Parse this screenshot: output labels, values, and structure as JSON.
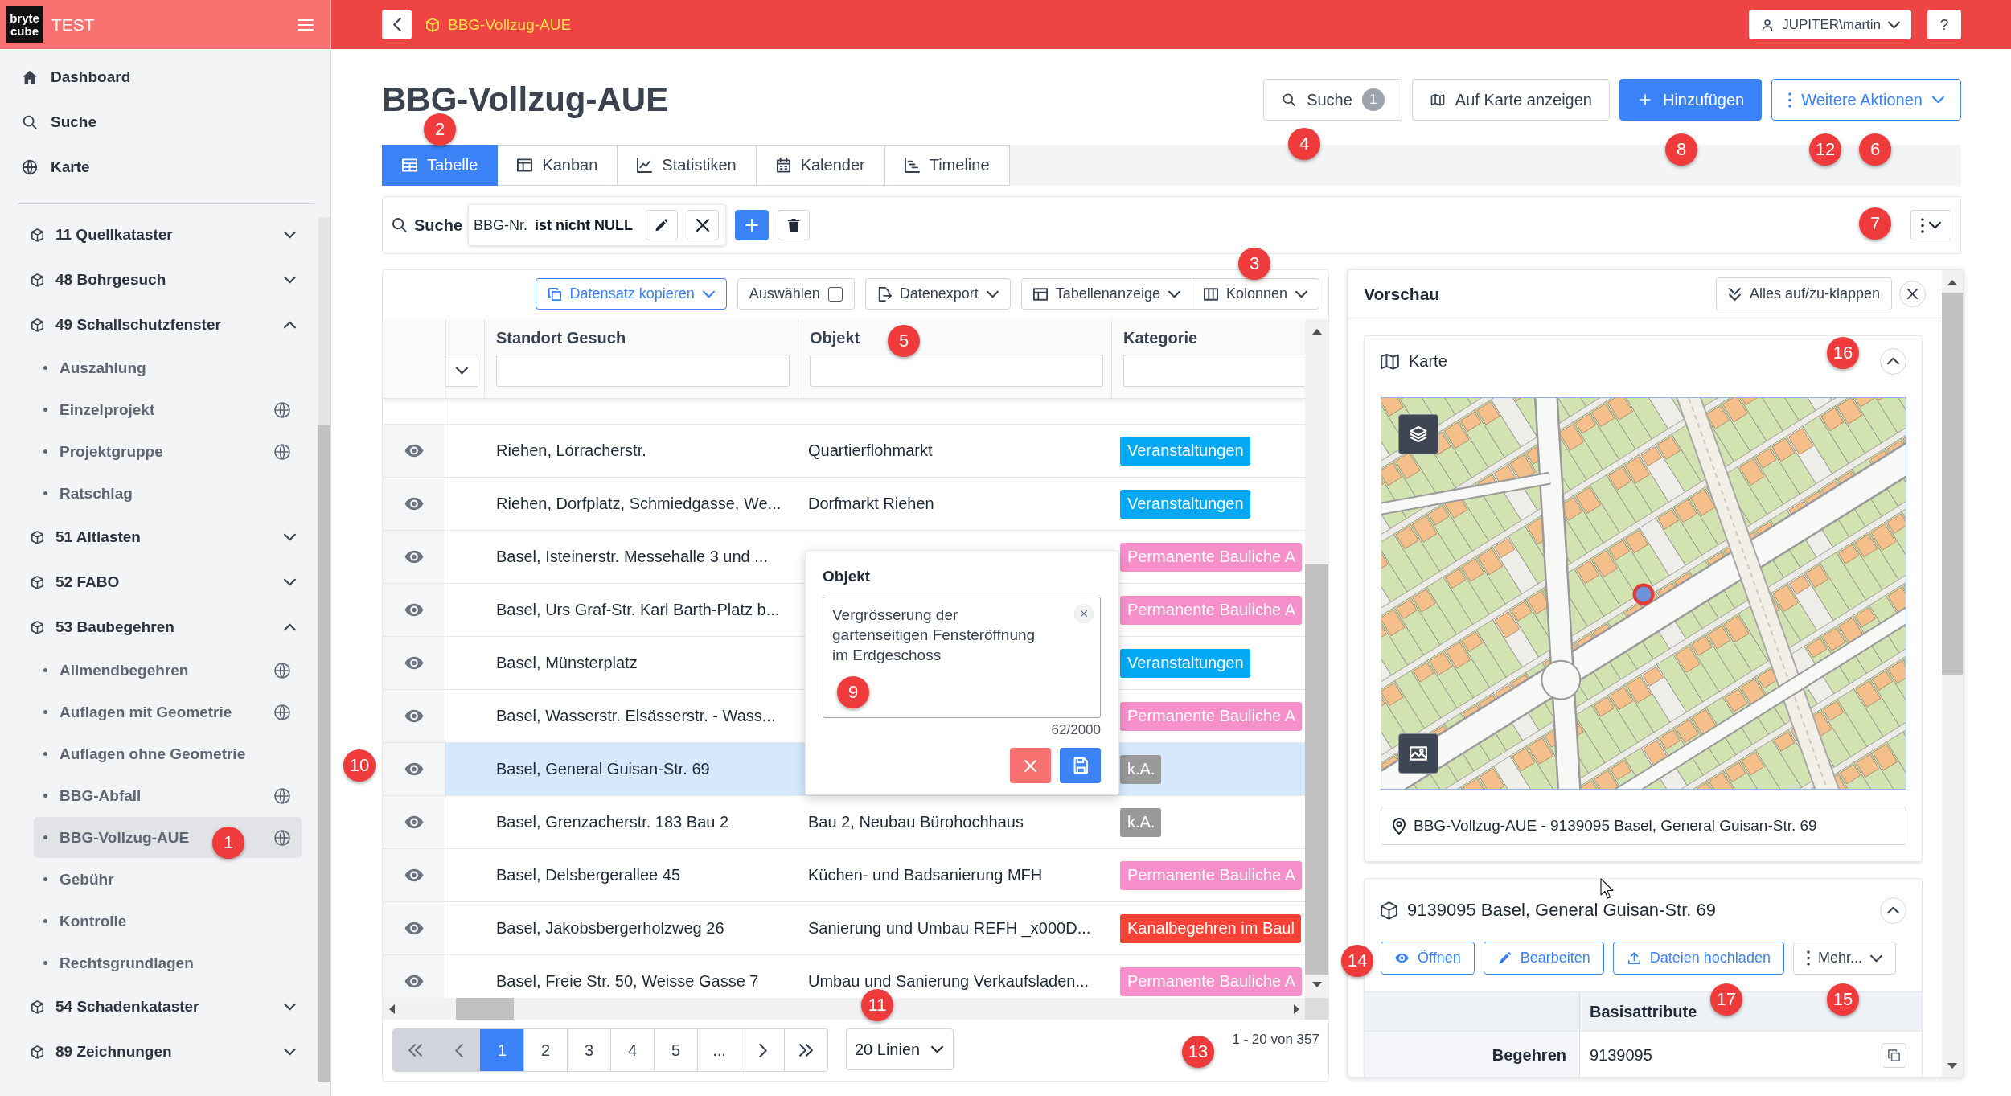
{
  "sidebar": {
    "logo": [
      "bryte",
      "cube"
    ],
    "title": "TEST",
    "nav": [
      {
        "kind": "dashboard",
        "label": "Dashboard"
      },
      {
        "kind": "search",
        "label": "Suche"
      },
      {
        "kind": "map",
        "label": "Karte"
      }
    ],
    "groups": [
      {
        "label": "11 Quellkataster",
        "expanded": false
      },
      {
        "label": "48 Bohrgesuch",
        "expanded": false
      },
      {
        "label": "49 Schallschutzfenster",
        "expanded": true,
        "children": [
          {
            "label": "Auszahlung",
            "globe_icon": false,
            "selected": false
          },
          {
            "label": "Einzelprojekt",
            "globe_icon": true,
            "selected": false
          },
          {
            "label": "Projektgruppe",
            "globe_icon": true,
            "selected": false
          },
          {
            "label": "Ratschlag",
            "globe_icon": false,
            "selected": false
          }
        ]
      },
      {
        "label": "51 Altlasten",
        "expanded": false
      },
      {
        "label": "52 FABO",
        "expanded": false
      },
      {
        "label": "53 Baubegehren",
        "expanded": true,
        "children": [
          {
            "label": "Allmendbegehren",
            "globe_icon": true,
            "selected": false
          },
          {
            "label": "Auflagen mit Geometrie",
            "globe_icon": true,
            "selected": false
          },
          {
            "label": "Auflagen ohne Geometrie",
            "globe_icon": false,
            "selected": false
          },
          {
            "label": "BBG-Abfall",
            "globe_icon": true,
            "selected": false
          },
          {
            "label": "BBG-Vollzug-AUE",
            "globe_icon": true,
            "selected": true
          },
          {
            "label": "Gebühr",
            "globe_icon": false,
            "selected": false
          },
          {
            "label": "Kontrolle",
            "globe_icon": false,
            "selected": false
          },
          {
            "label": "Rechtsgrundlagen",
            "globe_icon": false,
            "selected": false
          }
        ]
      },
      {
        "label": "54 Schadenkataster",
        "expanded": false
      },
      {
        "label": "89 Zeichnungen",
        "expanded": false
      }
    ]
  },
  "topbar": {
    "breadcrumb": "BBG-Vollzug-AUE",
    "user": "JUPITER\\martin",
    "help": "?"
  },
  "page": {
    "title": "BBG-Vollzug-AUE",
    "actions": [
      {
        "kind": "search",
        "label": "Suche",
        "count": "1"
      },
      {
        "kind": "map",
        "label": "Auf Karte anzeigen"
      },
      {
        "kind": "add",
        "label": "Hinzufügen"
      },
      {
        "kind": "more",
        "label": "Weitere Aktionen"
      }
    ]
  },
  "view_tabs": [
    {
      "kind": "table",
      "label": "Tabelle",
      "selected": true
    },
    {
      "kind": "kanban",
      "label": "Kanban",
      "selected": false
    },
    {
      "kind": "chart",
      "label": "Statistiken",
      "selected": false
    },
    {
      "kind": "calendar",
      "label": "Kalender",
      "selected": false
    },
    {
      "kind": "timeline",
      "label": "Timeline",
      "selected": false
    }
  ],
  "filter_bar": {
    "label": "Suche",
    "field": "BBG-Nr.",
    "condition": "ist nicht NULL"
  },
  "table_toolbar": [
    {
      "kind": "copy",
      "label": "Datensatz kopieren"
    },
    {
      "kind": "select",
      "label": "Auswählen",
      "checked": false
    },
    {
      "kind": "export",
      "label": "Datenexport"
    },
    {
      "kind": "layout",
      "label": "Tabellenanzeige"
    },
    {
      "kind": "columns",
      "label": "Kolonnen"
    }
  ],
  "table": {
    "columns": [
      {
        "label": "Standort Gesuch"
      },
      {
        "label": "Objekt"
      },
      {
        "label": "Kategorie"
      }
    ],
    "rows": [
      {
        "standort": "Riehen, Lörracherstr.",
        "objekt": "Quartierflohmarkt",
        "kategorie": {
          "label": "Veranstaltungen",
          "color": "#03a9f4"
        },
        "selected": false
      },
      {
        "standort": "Riehen, Dorfplatz, Schmiedgasse, We...",
        "objekt": "Dorfmarkt Riehen",
        "kategorie": {
          "label": "Veranstaltungen",
          "color": "#03a9f4"
        },
        "selected": false
      },
      {
        "standort": "Basel, Isteinerstr. Messehalle 3 und ...",
        "kategorie": {
          "label": "Permanente Bauliche A",
          "color": "#f78fcb"
        },
        "selected": false
      },
      {
        "standort": "Basel, Urs Graf-Str. Karl Barth-Platz b...",
        "kategorie": {
          "label": "Permanente Bauliche A",
          "color": "#f78fcb"
        },
        "selected": false
      },
      {
        "standort": "Basel, Münsterplatz",
        "kategorie": {
          "label": "Veranstaltungen",
          "color": "#03a9f4"
        },
        "selected": false
      },
      {
        "standort": "Basel, Wasserstr. Elsässerstr. - Wass...",
        "kategorie": {
          "label": "Permanente Bauliche A",
          "color": "#f78fcb"
        },
        "selected": false
      },
      {
        "standort": "Basel, General Guisan-Str. 69",
        "kategorie": {
          "label": "k.A.",
          "color": "#999999"
        },
        "selected": true
      },
      {
        "standort": "Basel, Grenzacherstr. 183 Bau 2",
        "objekt": "Bau 2, Neubau Bürohochhaus",
        "kategorie": {
          "label": "k.A.",
          "color": "#999999"
        },
        "selected": false
      },
      {
        "standort": "Basel, Delsbergerallee 45",
        "objekt": "Küchen- und Badsanierung MFH",
        "kategorie": {
          "label": "Permanente Bauliche A",
          "color": "#f78fcb"
        },
        "selected": false
      },
      {
        "standort": "Basel, Jakobsbergerholzweg 26",
        "objekt": "Sanierung und Umbau REFH _x000D...",
        "kategorie": {
          "label": "Kanalbegehren im Baul",
          "color": "#f44336"
        },
        "selected": false
      },
      {
        "standort": "Basel, Freie Str. 50, Weisse Gasse 7",
        "objekt": "Umbau und Sanierung Verkaufsladen...",
        "kategorie": {
          "label": "Permanente Bauliche A",
          "color": "#f78fcb"
        },
        "selected": false
      }
    ],
    "pagination": {
      "prev_disabled": true,
      "pages": [
        {
          "label": "1",
          "selected": true
        },
        {
          "label": "2",
          "selected": false
        },
        {
          "label": "3",
          "selected": false
        },
        {
          "label": "4",
          "selected": false
        },
        {
          "label": "5",
          "selected": false
        },
        {
          "label": "...",
          "selected": false
        }
      ],
      "page_size": "20 Linien",
      "range": "1 - 20 von 357"
    }
  },
  "edit_popup": {
    "label": "Objekt",
    "value": "Vergrösserung der gartenseitigen Fensteröffnung im Erdgeschoss",
    "counter": "62/2000"
  },
  "preview": {
    "title": "Vorschau",
    "toggle_all": "Alles auf/zu-klappen",
    "map_card": {
      "title": "Karte",
      "expanded": true,
      "location": "BBG-Vollzug-AUE - 9139095 Basel, General Guisan-Str. 69"
    },
    "record_card": {
      "title": "9139095 Basel, General Guisan-Str. 69",
      "expanded": true,
      "buttons": [
        {
          "kind": "open",
          "label": "Öffnen"
        },
        {
          "kind": "edit",
          "label": "Bearbeiten"
        },
        {
          "kind": "upload",
          "label": "Dateien hochladen"
        },
        {
          "kind": "more",
          "label": "Mehr..."
        }
      ],
      "attributes": {
        "heading": "Basisattribute",
        "rows": [
          {
            "name": "Begehren",
            "value": "9139095"
          }
        ]
      }
    }
  },
  "callouts": [
    {
      "label": "1"
    },
    {
      "label": "2"
    },
    {
      "label": "3"
    },
    {
      "label": "4"
    },
    {
      "label": "5"
    },
    {
      "label": "6"
    },
    {
      "label": "7"
    },
    {
      "label": "8"
    },
    {
      "label": "9"
    },
    {
      "label": "10"
    },
    {
      "label": "11"
    },
    {
      "label": "12"
    },
    {
      "label": "13"
    },
    {
      "label": "14"
    },
    {
      "label": "15"
    },
    {
      "label": "16"
    },
    {
      "label": "17"
    }
  ]
}
